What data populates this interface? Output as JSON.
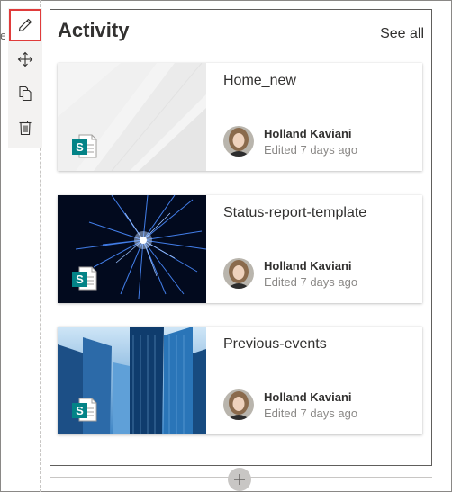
{
  "left_stub": {
    "text": "e"
  },
  "webpart": {
    "title": "Activity",
    "see_all_label": "See all"
  },
  "cards": [
    {
      "title": "Home_new",
      "author": "Holland Kaviani",
      "edited": "Edited 7 days ago",
      "thumbnail": "abstract-gray"
    },
    {
      "title": "Status-report-template",
      "author": "Holland Kaviani",
      "edited": "Edited 7 days ago",
      "thumbnail": "fireworks"
    },
    {
      "title": "Previous-events",
      "author": "Holland Kaviani",
      "edited": "Edited 7 days ago",
      "thumbnail": "city-buildings"
    }
  ],
  "toolbar": {
    "items": [
      "pencil-icon",
      "move-icon",
      "duplicate-icon",
      "delete-icon"
    ]
  },
  "colors": {
    "highlight": "#e03b3b",
    "sharepoint": "#038387"
  }
}
